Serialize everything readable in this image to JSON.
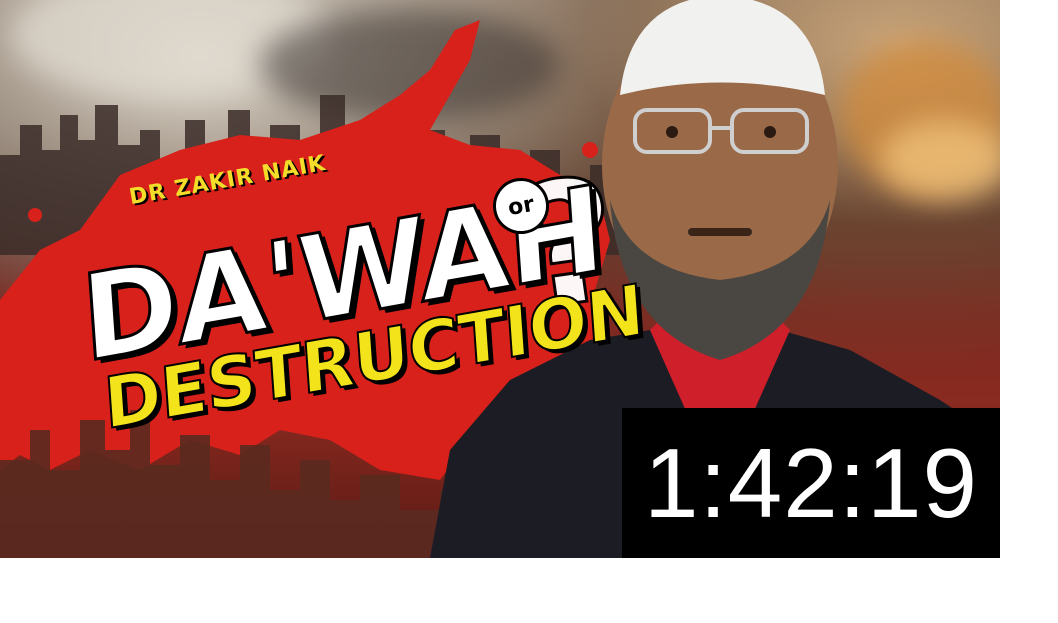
{
  "video": {
    "brand_text": "DR ZAKIR NAIK",
    "title_main": "DA'WAH",
    "title_connector": "or",
    "title_sub": "DESTRUCTION",
    "title_mark": "?",
    "duration": "1:42:19"
  },
  "colors": {
    "title_white": "#ffffff",
    "title_yellow": "#f2e31b",
    "splash_red": "#d8211b",
    "duration_bg": "#000000"
  },
  "icons": {
    "thumbnail": "video-thumbnail-image",
    "question": "question-mark"
  }
}
